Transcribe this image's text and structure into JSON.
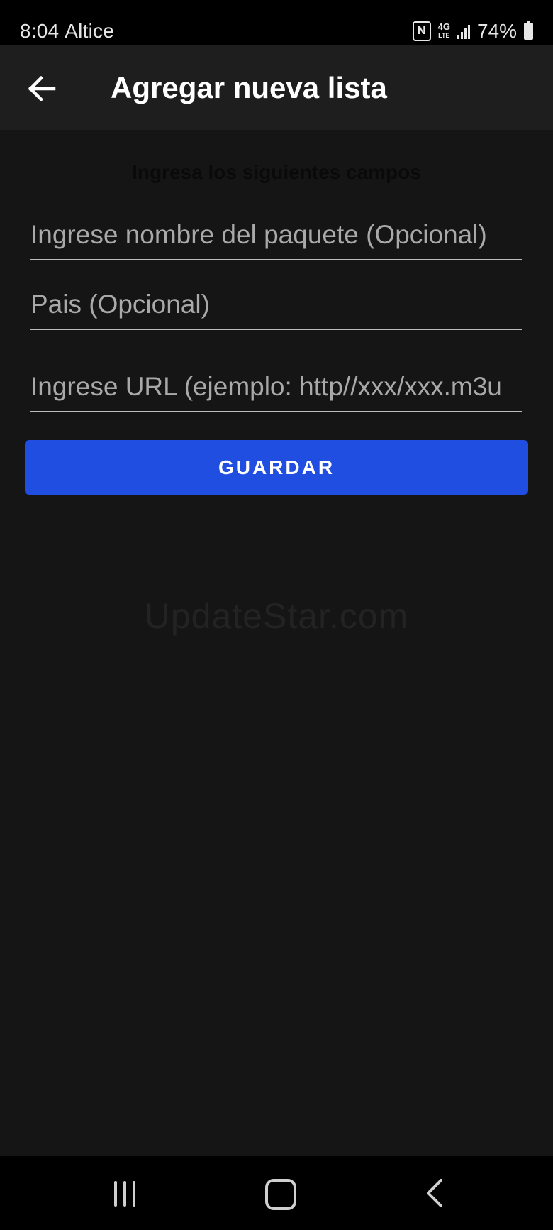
{
  "status_bar": {
    "time": "8:04",
    "carrier": "Altice",
    "nfc_label": "N",
    "network": "4G",
    "network_sub": "LTE",
    "battery": "74%"
  },
  "app_bar": {
    "title": "Agregar nueva lista"
  },
  "form": {
    "heading": "Ingresa los siguientes campos",
    "name_placeholder": "Ingrese nombre del paquete (Opcional)",
    "country_placeholder": "Pais (Opcional)",
    "url_placeholder": "Ingrese URL (ejemplo: http//xxx/xxx.m3u",
    "save_label": "GUARDAR"
  },
  "watermark": "UpdateStar.com",
  "colors": {
    "accent": "#1f4ee0",
    "background": "#151515",
    "app_bar": "#1e1e1e"
  },
  "icons": {
    "back": "arrow-left-icon",
    "nav_recent": "recent-apps-icon",
    "nav_home": "home-icon",
    "nav_back": "chevron-left-icon"
  }
}
